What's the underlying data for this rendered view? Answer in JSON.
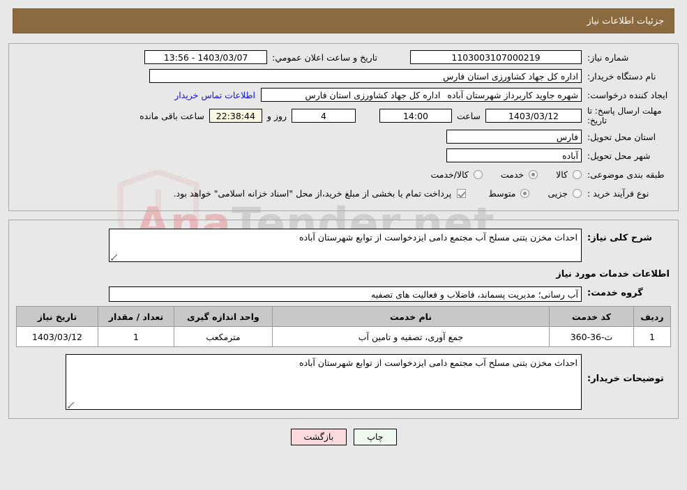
{
  "window": {
    "title": "جزئیات اطلاعات نیاز",
    "header_bg": "#8a6a3e"
  },
  "watermark": {
    "text_left": "Ana",
    "text_right": "Tender.net"
  },
  "need_info": {
    "need_number_label": "شماره نیاز:",
    "need_number_value": "1103003107000219",
    "announce_label": "تاریخ و ساعت اعلان عمومي:",
    "announce_value": "1403/03/07 - 13:56",
    "buyer_org_label": "نام دستگاه خریدار:",
    "buyer_org_value": "اداره کل جهاد کشاورزی استان فارس",
    "creator_label": "ایجاد کننده درخواست:",
    "creator_value": "شهره  جاوید  کاربرداز شهرستان آباده",
    "creator_org_value": "اداره کل جهاد کشاورزی استان فارس",
    "contact_link": "اطلاعات تماس خریدار",
    "deadline_label": "مهلت ارسال پاسخ: تا تاریخ:",
    "deadline_date": "1403/03/12",
    "hour_label": "ساعت",
    "deadline_time": "14:00",
    "days_left": "4",
    "days_label": "روز و",
    "countdown": "22:38:44",
    "countdown_label": "ساعت باقی مانده",
    "province_label": "استان محل تحویل:",
    "province_value": "فارس",
    "city_label": "شهر محل تحویل:",
    "city_value": "آباده",
    "category_label": "طبقه بندی موضوعی:",
    "category_options": [
      {
        "label": "کالا",
        "selected": false
      },
      {
        "label": "خدمت",
        "selected": true
      },
      {
        "label": "کالا/خدمت",
        "selected": false
      }
    ],
    "process_label": "نوع فرآیند خرید :",
    "process_options": [
      {
        "label": "جزیی",
        "selected": false
      },
      {
        "label": "متوسط",
        "selected": true
      }
    ],
    "treasury_checked": true,
    "treasury_note": "پرداخت تمام یا بخشی از مبلغ خرید،از محل \"اسناد خزانه اسلامی\" خواهد بود."
  },
  "description": {
    "general_label": "شرح کلی نیاز:",
    "general_value": "احداث مخزن بتنی مسلح آب مجتمع دامی ایزدخواست از توابع شهرستان آباده",
    "services_heading": "اطلاعات خدمات مورد نیاز",
    "service_group_label": "گروه خدمت:",
    "service_group_value": "آب رسانی؛ مدیریت پسماند، فاضلاب و فعالیت های تصفیه"
  },
  "items_table": {
    "columns": [
      "ردیف",
      "کد خدمت",
      "نام خدمت",
      "واحد اندازه گیری",
      "تعداد / مقدار",
      "تاریخ نیاز"
    ],
    "rows": [
      {
        "row_no": "1",
        "service_code": "ث-36-360",
        "service_name": "جمع آوری، تصفیه و تامین آب",
        "unit": "مترمکعب",
        "quantity": "1",
        "need_date": "1403/03/12"
      }
    ]
  },
  "buyer_notes": {
    "label": "توضیحات خریدار:",
    "value": "احداث مخزن بتنی مسلح آب مجتمع دامی ایزدخواست از توابع شهرستان آباده"
  },
  "footer": {
    "print_label": "چاپ",
    "back_label": "بازگشت"
  }
}
